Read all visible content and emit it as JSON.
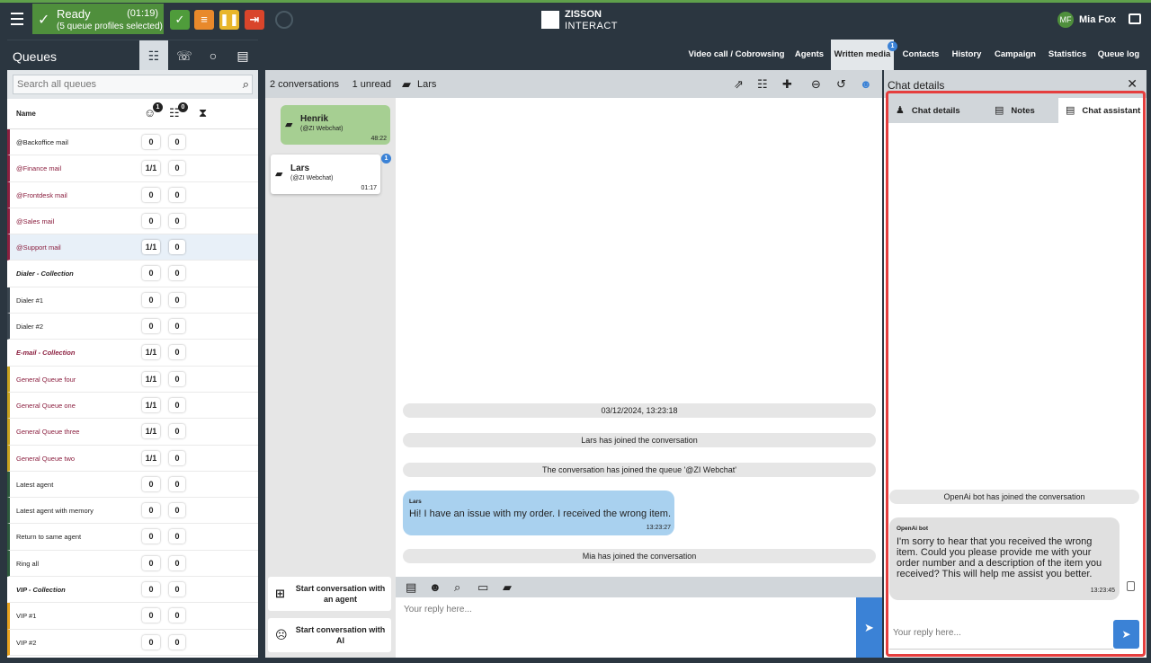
{
  "status": {
    "label": "Ready",
    "timer": "(01:19)",
    "profiles": "(5 queue profiles selected)"
  },
  "logo": {
    "line1": "ZISSON",
    "line2": "INTERACT"
  },
  "user": {
    "initials": "MF",
    "name": "Mia Fox"
  },
  "queues": {
    "title": "Queues",
    "search_placeholder": "Search all queues",
    "col_name": "Name",
    "agents_badge": "1",
    "waiting_badge": "0",
    "rows": [
      {
        "name": "@Backoffice mail",
        "c1": "0",
        "c2": "0",
        "color": "#8b1f3f"
      },
      {
        "name": "@Finance mail",
        "c1": "1/1",
        "c2": "0",
        "color": "#8b1f3f"
      },
      {
        "name": "@Frontdesk mail",
        "c1": "0",
        "c2": "0",
        "color": "#8b1f3f"
      },
      {
        "name": "@Sales mail",
        "c1": "0",
        "c2": "0",
        "color": "#8b1f3f"
      },
      {
        "name": "@Support mail",
        "c1": "1/1",
        "c2": "0",
        "color": "#8b1f3f"
      },
      {
        "name": "Dialer - Collection",
        "c1": "0",
        "c2": "0",
        "color": "#ffffff"
      },
      {
        "name": "Dialer #1",
        "c1": "0",
        "c2": "0",
        "color": "#3a4650"
      },
      {
        "name": "Dialer #2",
        "c1": "0",
        "c2": "0",
        "color": "#3a4650"
      },
      {
        "name": "E-mail - Collection",
        "c1": "1/1",
        "c2": "0",
        "color": "#ffffff"
      },
      {
        "name": "General Queue four",
        "c1": "1/1",
        "c2": "0",
        "color": "#c8a21e"
      },
      {
        "name": "General Queue one",
        "c1": "1/1",
        "c2": "0",
        "color": "#c8a21e"
      },
      {
        "name": "General Queue three",
        "c1": "1/1",
        "c2": "0",
        "color": "#c8a21e"
      },
      {
        "name": "General Queue two",
        "c1": "1/1",
        "c2": "0",
        "color": "#c8a21e"
      },
      {
        "name": "Latest agent",
        "c1": "0",
        "c2": "0",
        "color": "#2d5a3d"
      },
      {
        "name": "Latest agent with memory",
        "c1": "0",
        "c2": "0",
        "color": "#2d5a3d"
      },
      {
        "name": "Return to same agent",
        "c1": "0",
        "c2": "0",
        "color": "#2d5a3d"
      },
      {
        "name": "Ring all",
        "c1": "0",
        "c2": "0",
        "color": "#2d5a3d"
      },
      {
        "name": "VIP - Collection",
        "c1": "0",
        "c2": "0",
        "color": "#ffffff"
      },
      {
        "name": "VIP #1",
        "c1": "0",
        "c2": "0",
        "color": "#e8a21e"
      },
      {
        "name": "VIP #2",
        "c1": "0",
        "c2": "0",
        "color": "#e8a21e"
      }
    ]
  },
  "menu": {
    "tabs": [
      "Video call / Cobrowsing",
      "Agents",
      "Written media",
      "Contacts",
      "History",
      "Campaign",
      "Statistics",
      "Queue log"
    ],
    "written_badge": "1"
  },
  "conversations": {
    "count": "2 conversations",
    "unread": "1 unread",
    "items": [
      {
        "name": "Henrik",
        "source": "(@ZI Webchat)",
        "time": "48:22"
      },
      {
        "name": "Lars",
        "source": "(@ZI Webchat)",
        "time": "01:17",
        "badge": "1"
      }
    ],
    "start_agent": "Start conversation with an agent",
    "start_ai": "Start conversation with AI"
  },
  "chat": {
    "title": "Lars",
    "messages": {
      "date": "03/12/2024, 13:23:18",
      "joined": "Lars has joined the conversation",
      "queue": "The conversation has joined the queue '@ZI Webchat'",
      "sender": "Lars",
      "text": "Hi! I have an issue with my order. I received the wrong item.",
      "time": "13:23:27",
      "agent_joined": "Mia has joined the conversation"
    },
    "reply_placeholder": "Your reply here..."
  },
  "details": {
    "title": "Chat details",
    "tabs": [
      "Chat details",
      "Notes",
      "Chat assistant"
    ],
    "bot_joined": "OpenAi bot has joined the conversation",
    "bot_sender": "OpenAi bot",
    "bot_text": "I'm sorry to hear that you received the wrong item. Could you please provide me with your order number and a description of the item you received? This will help me assist you better.",
    "bot_time": "13:23:45",
    "reply_placeholder": "Your reply here..."
  }
}
